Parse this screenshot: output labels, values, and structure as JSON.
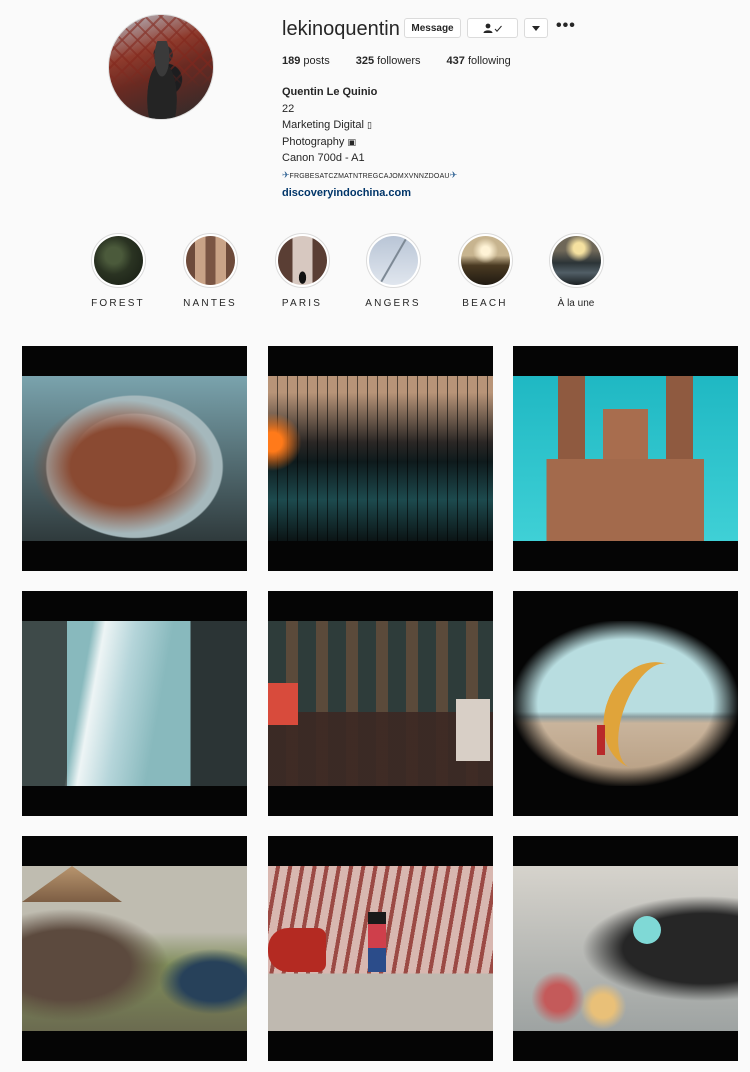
{
  "profile": {
    "username": "lekinoquentin",
    "message_label": "Message",
    "follow_icon": "person-check-icon",
    "dropdown_icon": "caret-down-icon",
    "more_label": "•••",
    "stats": {
      "posts_count": "189",
      "posts_label": "posts",
      "followers_count": "325",
      "followers_label": "followers",
      "following_count": "437",
      "following_label": "following"
    },
    "bio": {
      "full_name": "Quentin Le Quinio",
      "line1": "22",
      "line2": "Marketing Digital",
      "line3": "Photography",
      "line4": "Canon 700d - A1",
      "line5": "FRGBESATCZMATNTREGCAJOMXVNNZDOAU",
      "link": "discoveryindochina.com"
    }
  },
  "highlights": [
    {
      "label": "FOREST"
    },
    {
      "label": "NANTES"
    },
    {
      "label": "PARIS"
    },
    {
      "label": "ANGERS"
    },
    {
      "label": "BEACH"
    },
    {
      "label": "À la une"
    }
  ],
  "colors": {
    "link": "#003569",
    "border": "#dbdbdb",
    "background": "#fafafa"
  }
}
